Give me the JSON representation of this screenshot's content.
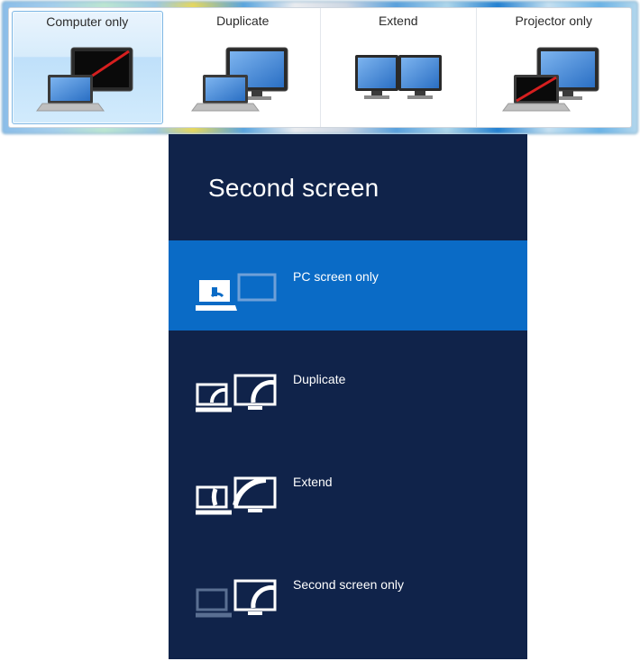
{
  "win7": {
    "options": [
      {
        "label": "Computer only",
        "selected": true
      },
      {
        "label": "Duplicate",
        "selected": false
      },
      {
        "label": "Extend",
        "selected": false
      },
      {
        "label": "Projector only",
        "selected": false
      }
    ]
  },
  "win8": {
    "title": "Second screen",
    "options": [
      {
        "label": "PC screen only",
        "selected": true
      },
      {
        "label": "Duplicate",
        "selected": false
      },
      {
        "label": "Extend",
        "selected": false
      },
      {
        "label": "Second screen only",
        "selected": false
      }
    ]
  }
}
